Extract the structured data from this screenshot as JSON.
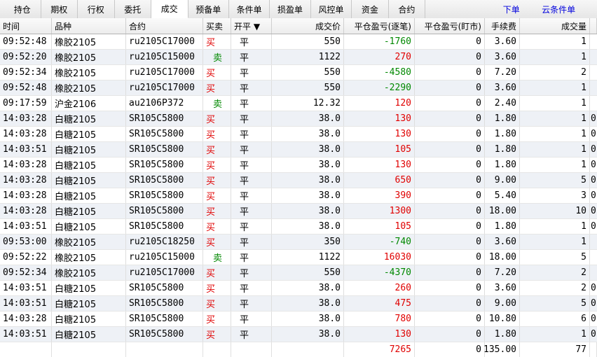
{
  "tabs": [
    {
      "label": "持仓",
      "active": false
    },
    {
      "label": "期权",
      "active": false
    },
    {
      "label": "行权",
      "active": false
    },
    {
      "label": "委托",
      "active": false
    },
    {
      "label": "成交",
      "active": true
    },
    {
      "label": "预备单",
      "active": false
    },
    {
      "label": "条件单",
      "active": false
    },
    {
      "label": "损盈单",
      "active": false
    },
    {
      "label": "风控单",
      "active": false
    },
    {
      "label": "资金",
      "active": false
    },
    {
      "label": "合约",
      "active": false
    }
  ],
  "links": {
    "order": "下单",
    "cloud_condition": "云条件单"
  },
  "columns": {
    "time": "时间",
    "product": "品种",
    "contract": "合约",
    "side": "买卖",
    "open_close": "开平 ▼",
    "price": "成交价",
    "pl_trade": "平仓盈亏(逐笔)",
    "pl_mark": "平仓盈亏(盯市)",
    "fee": "手续费",
    "volume": "成交量"
  },
  "rows": [
    {
      "time": "09:52:48",
      "product": "橡胶2105",
      "contract": "ru2105C17000",
      "side": "买",
      "oc": "平",
      "price": "550",
      "pl_trade": "-1760",
      "pl_mark": "0",
      "fee": "3.60",
      "volume": "1",
      "extra": ""
    },
    {
      "time": "09:52:20",
      "product": "橡胶2105",
      "contract": "ru2105C15000",
      "side": "卖",
      "oc": "平",
      "price": "1122",
      "pl_trade": "270",
      "pl_mark": "0",
      "fee": "3.60",
      "volume": "1",
      "extra": ""
    },
    {
      "time": "09:52:34",
      "product": "橡胶2105",
      "contract": "ru2105C17000",
      "side": "买",
      "oc": "平",
      "price": "550",
      "pl_trade": "-4580",
      "pl_mark": "0",
      "fee": "7.20",
      "volume": "2",
      "extra": ""
    },
    {
      "time": "09:52:48",
      "product": "橡胶2105",
      "contract": "ru2105C17000",
      "side": "买",
      "oc": "平",
      "price": "550",
      "pl_trade": "-2290",
      "pl_mark": "0",
      "fee": "3.60",
      "volume": "1",
      "extra": ""
    },
    {
      "time": "09:17:59",
      "product": "沪金2106",
      "contract": "au2106P372",
      "side": "卖",
      "oc": "平",
      "price": "12.32",
      "pl_trade": "120",
      "pl_mark": "0",
      "fee": "2.40",
      "volume": "1",
      "extra": ""
    },
    {
      "time": "14:03:28",
      "product": "白糖2105",
      "contract": "SR105C5800",
      "side": "买",
      "oc": "平",
      "price": "38.0",
      "pl_trade": "130",
      "pl_mark": "0",
      "fee": "1.80",
      "volume": "1",
      "extra": "0"
    },
    {
      "time": "14:03:28",
      "product": "白糖2105",
      "contract": "SR105C5800",
      "side": "买",
      "oc": "平",
      "price": "38.0",
      "pl_trade": "130",
      "pl_mark": "0",
      "fee": "1.80",
      "volume": "1",
      "extra": "0"
    },
    {
      "time": "14:03:51",
      "product": "白糖2105",
      "contract": "SR105C5800",
      "side": "买",
      "oc": "平",
      "price": "38.0",
      "pl_trade": "105",
      "pl_mark": "0",
      "fee": "1.80",
      "volume": "1",
      "extra": "0"
    },
    {
      "time": "14:03:28",
      "product": "白糖2105",
      "contract": "SR105C5800",
      "side": "买",
      "oc": "平",
      "price": "38.0",
      "pl_trade": "130",
      "pl_mark": "0",
      "fee": "1.80",
      "volume": "1",
      "extra": "0"
    },
    {
      "time": "14:03:28",
      "product": "白糖2105",
      "contract": "SR105C5800",
      "side": "买",
      "oc": "平",
      "price": "38.0",
      "pl_trade": "650",
      "pl_mark": "0",
      "fee": "9.00",
      "volume": "5",
      "extra": "0"
    },
    {
      "time": "14:03:28",
      "product": "白糖2105",
      "contract": "SR105C5800",
      "side": "买",
      "oc": "平",
      "price": "38.0",
      "pl_trade": "390",
      "pl_mark": "0",
      "fee": "5.40",
      "volume": "3",
      "extra": "0"
    },
    {
      "time": "14:03:28",
      "product": "白糖2105",
      "contract": "SR105C5800",
      "side": "买",
      "oc": "平",
      "price": "38.0",
      "pl_trade": "1300",
      "pl_mark": "0",
      "fee": "18.00",
      "volume": "10",
      "extra": "0"
    },
    {
      "time": "14:03:51",
      "product": "白糖2105",
      "contract": "SR105C5800",
      "side": "买",
      "oc": "平",
      "price": "38.0",
      "pl_trade": "105",
      "pl_mark": "0",
      "fee": "1.80",
      "volume": "1",
      "extra": "0"
    },
    {
      "time": "09:53:00",
      "product": "橡胶2105",
      "contract": "ru2105C18250",
      "side": "买",
      "oc": "平",
      "price": "350",
      "pl_trade": "-740",
      "pl_mark": "0",
      "fee": "3.60",
      "volume": "1",
      "extra": ""
    },
    {
      "time": "09:52:22",
      "product": "橡胶2105",
      "contract": "ru2105C15000",
      "side": "卖",
      "oc": "平",
      "price": "1122",
      "pl_trade": "16030",
      "pl_mark": "0",
      "fee": "18.00",
      "volume": "5",
      "extra": ""
    },
    {
      "time": "09:52:34",
      "product": "橡胶2105",
      "contract": "ru2105C17000",
      "side": "买",
      "oc": "平",
      "price": "550",
      "pl_trade": "-4370",
      "pl_mark": "0",
      "fee": "7.20",
      "volume": "2",
      "extra": ""
    },
    {
      "time": "14:03:51",
      "product": "白糖2105",
      "contract": "SR105C5800",
      "side": "买",
      "oc": "平",
      "price": "38.0",
      "pl_trade": "260",
      "pl_mark": "0",
      "fee": "3.60",
      "volume": "2",
      "extra": "0"
    },
    {
      "time": "14:03:51",
      "product": "白糖2105",
      "contract": "SR105C5800",
      "side": "买",
      "oc": "平",
      "price": "38.0",
      "pl_trade": "475",
      "pl_mark": "0",
      "fee": "9.00",
      "volume": "5",
      "extra": "0"
    },
    {
      "time": "14:03:28",
      "product": "白糖2105",
      "contract": "SR105C5800",
      "side": "买",
      "oc": "平",
      "price": "38.0",
      "pl_trade": "780",
      "pl_mark": "0",
      "fee": "10.80",
      "volume": "6",
      "extra": "0"
    },
    {
      "time": "14:03:51",
      "product": "白糖2105",
      "contract": "SR105C5800",
      "side": "买",
      "oc": "平",
      "price": "38.0",
      "pl_trade": "130",
      "pl_mark": "0",
      "fee": "1.80",
      "volume": "1",
      "extra": "0"
    }
  ],
  "totals": {
    "pl_trade": "7265",
    "pl_mark": "0",
    "fee": "135.00",
    "volume": "77"
  },
  "colors": {
    "buy": "#e00000",
    "sell": "#008800",
    "profit": "#e00000",
    "loss": "#008800",
    "link": "#0000dd"
  }
}
